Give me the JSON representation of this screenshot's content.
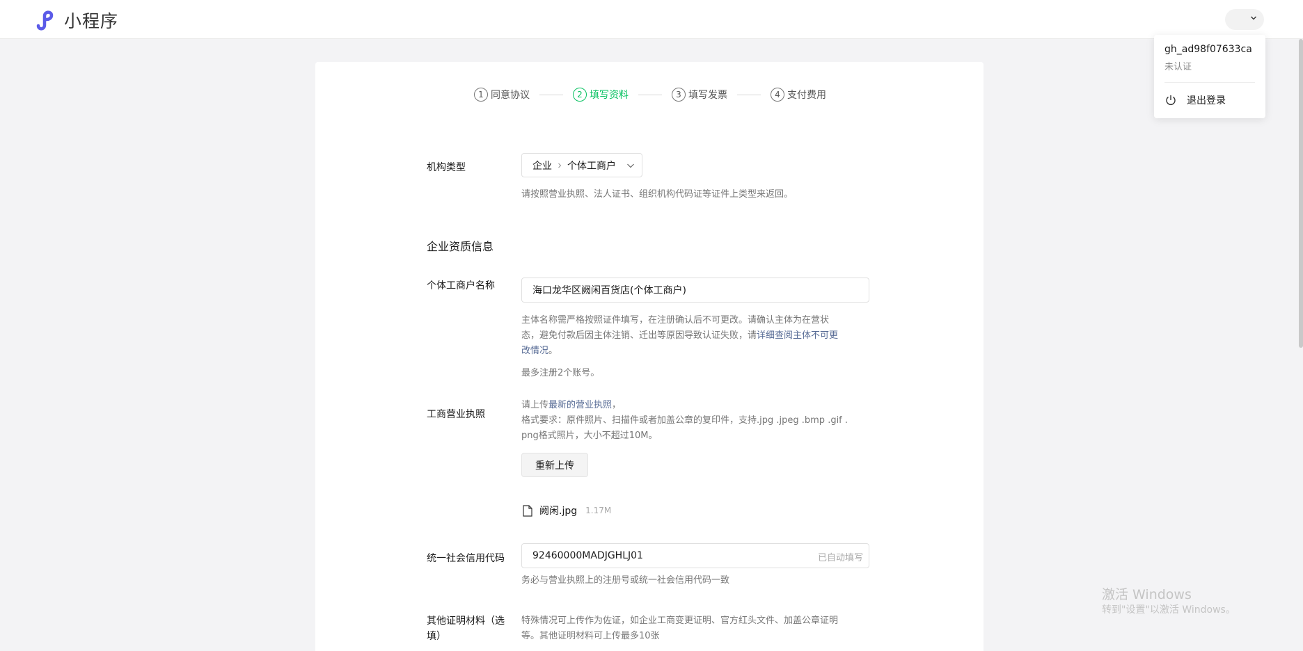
{
  "header": {
    "app_title": "小程序",
    "logo_icon": "miniprogram-logo-icon",
    "accent_color": "#5b5be8"
  },
  "account_menu": {
    "account_id": "gh_ad98f07633ca",
    "status": "未认证",
    "logout_label": "退出登录"
  },
  "steps": [
    {
      "num": "1",
      "label": "同意协议",
      "active": false
    },
    {
      "num": "2",
      "label": "填写资料",
      "active": true
    },
    {
      "num": "3",
      "label": "填写发票",
      "active": false
    },
    {
      "num": "4",
      "label": "支付费用",
      "active": false
    }
  ],
  "form": {
    "org_type": {
      "label": "机构类型",
      "value_primary": "企业",
      "value_secondary": "个体工商户",
      "hint": "请按照营业执照、法人证书、组织机构代码证等证件上类型来返回。"
    },
    "section_title": "企业资质信息",
    "business_name": {
      "label": "个体工商户名称",
      "value": "海口龙华区阙闲百货店(个体工商户)",
      "hint_line1": "主体名称需严格按照证件填写，在注册确认后不可更改。请确认主体为在营状",
      "hint_line2_plain": "态，避免付款后因主体注销、迁出等原因导致认证失败，请",
      "hint_line2_link": "详细查阅主体不可更",
      "hint_line3_link": "改情况",
      "hint_line3_plain": "。",
      "limit_hint": "最多注册2个账号。"
    },
    "license": {
      "label": "工商营业执照",
      "hint_prefix": "请上传",
      "hint_link": "最新的营业执照",
      "hint_suffix": "，",
      "format_line1": "格式要求：原件照片、扫描件或者加盖公章的复印件，支持.jpg .jpeg .bmp .gif .",
      "format_line2": "png格式照片，大小不超过10M。",
      "reupload_label": "重新上传",
      "file_name": "阙闲.jpg",
      "file_size": "1.17M"
    },
    "credit_code": {
      "label": "统一社会信用代码",
      "value": "92460000MADJGHLJ01",
      "suffix": "已自动填写",
      "hint": "务必与营业执照上的注册号或统一社会信用代码一致"
    },
    "other_docs": {
      "label_line1": "其他证明材料（选",
      "label_line2": "填）",
      "hint_line1": "特殊情况可上传作为佐证，如企业工商变更证明、官方红头文件、加盖公章证明",
      "hint_line2": "等。其他证明材料可上传最多10张"
    }
  },
  "watermark": {
    "line1": "激活 Windows",
    "line2": "转到\"设置\"以激活 Windows。"
  }
}
